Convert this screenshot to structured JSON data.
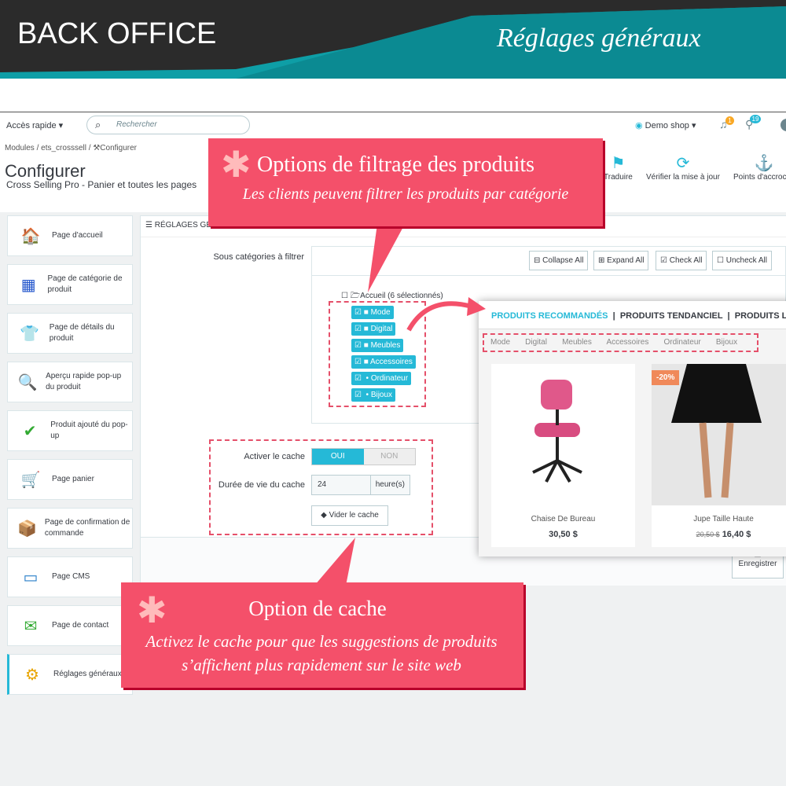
{
  "banner": {
    "left": "BACK OFFICE",
    "right": "Réglages généraux"
  },
  "topbar": {
    "quick_access": "Accès rapide",
    "search_placeholder": "Rechercher",
    "shop": "Demo shop",
    "notif_count": "1",
    "orders_count": "19"
  },
  "breadcrumb": [
    "Modules",
    "ets_crosssell",
    "Configurer"
  ],
  "page": {
    "title": "Configurer",
    "subtitle": "Cross Selling Pro - Panier et toutes les pages"
  },
  "toolbar": [
    {
      "label": "Traduire",
      "icon": "flag-icon"
    },
    {
      "label": "Vérifier la mise à jour",
      "icon": "refresh-icon"
    },
    {
      "label": "Points d'accroche",
      "icon": "anchor-icon"
    }
  ],
  "sidebar": [
    {
      "label": "Page d'accueil",
      "icon": "🏠"
    },
    {
      "label": "Page de catégorie de produit",
      "icon": "▦"
    },
    {
      "label": "Page de détails du produit",
      "icon": "👕"
    },
    {
      "label": "Aperçu rapide pop-up du produit",
      "icon": "🔍"
    },
    {
      "label": "Produit ajouté du pop-up",
      "icon": "✔"
    },
    {
      "label": "Page panier",
      "icon": "🛒"
    },
    {
      "label": "Page de confirmation de commande",
      "icon": "📦"
    },
    {
      "label": "Page CMS",
      "icon": "▭"
    },
    {
      "label": "Page de contact",
      "icon": "✉"
    },
    {
      "label": "Réglages généraux",
      "icon": "⚙"
    }
  ],
  "panel": {
    "heading": "Réglages généraux",
    "subcat_label": "Sous catégories à filtrer",
    "tree_buttons": [
      "Collapse All",
      "Expand All",
      "Check All",
      "Uncheck All"
    ],
    "root": "Accueil (6 sélectionnés)",
    "categories": [
      {
        "name": "Mode",
        "checked": true
      },
      {
        "name": "Digital",
        "checked": true
      },
      {
        "name": "Meubles",
        "checked": true
      },
      {
        "name": "Accessoires",
        "checked": true
      },
      {
        "name": "Ordinateur",
        "checked": true
      },
      {
        "name": "Bijoux",
        "checked": true
      }
    ],
    "cache_label": "Activer le cache",
    "cache_on": "OUI",
    "cache_off": "NON",
    "lifetime_label": "Durée de vie du cache",
    "lifetime_value": "24",
    "lifetime_unit": "heure(s)",
    "clear_cache": "Vider le cache",
    "save": "Enregistrer"
  },
  "callout1": {
    "title": "Options de filtrage des produits",
    "text": "Les clients peuvent filtrer les produits par catégorie"
  },
  "callout2": {
    "title": "Option de cache",
    "text": "Activez le cache pour que les suggestions de produits s’affichent plus rapidement sur le site web"
  },
  "preview": {
    "tabs": [
      "PRODUITS RECOMMANDÉS",
      "PRODUITS TENDANCIEL",
      "PRODUITS L"
    ],
    "filters": [
      "Mode",
      "Digital",
      "Meubles",
      "Accessoires",
      "Ordinateur",
      "Bijoux"
    ],
    "products": [
      {
        "name": "Chaise De Bureau",
        "price": "30,50 $"
      },
      {
        "name": "Jupe Taille Haute",
        "old_price": "20,50 $",
        "price": "16,40 $",
        "discount": "-20%"
      }
    ]
  },
  "colors": {
    "accent": "#25b9d7",
    "callout": "#f4506a",
    "banner_teal": "#0e9ea6"
  }
}
